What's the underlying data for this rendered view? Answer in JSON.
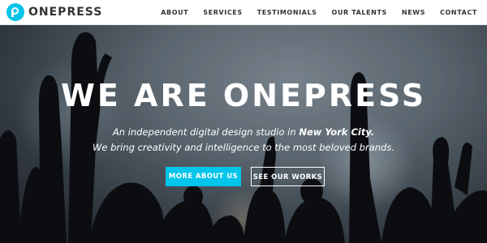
{
  "brand": {
    "name": "ONEPRESS",
    "icon": "p-logo-icon",
    "accent": "#03c4eb"
  },
  "nav": {
    "items": [
      "ABOUT",
      "SERVICES",
      "TESTIMONIALS",
      "OUR TALENTS",
      "NEWS",
      "CONTACT"
    ]
  },
  "hero": {
    "title": "WE ARE ONEPRESS",
    "tagline_line1_prefix": "An independent digital design studio in ",
    "tagline_line1_emphasis": "New York City.",
    "tagline_line2": "We bring creativity and intelligence to the most beloved brands.",
    "primary_button": "MORE ABOUT US",
    "secondary_button": "SEE OUR WORKS"
  }
}
